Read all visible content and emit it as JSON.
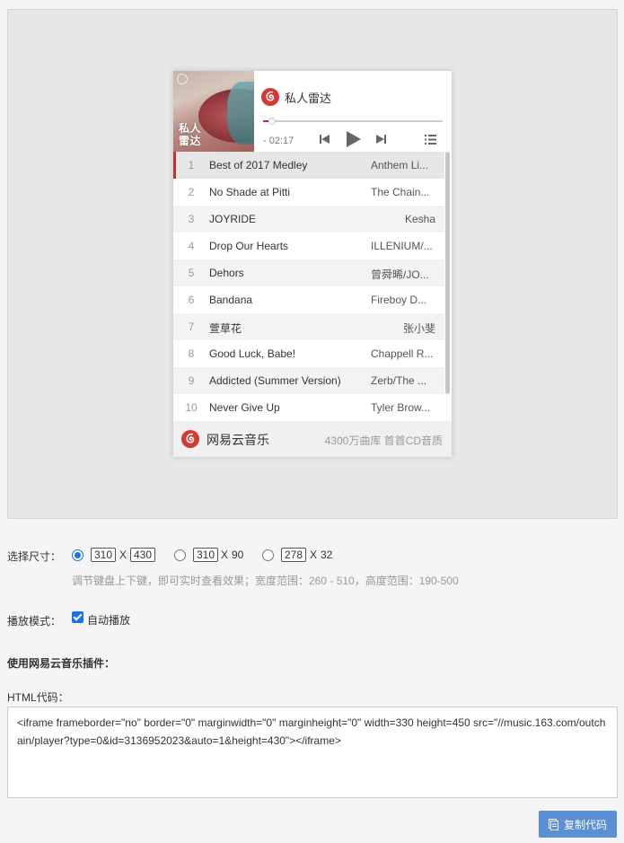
{
  "player": {
    "cover_text": "私人雷达",
    "title": "私人雷达",
    "time": "- 02:17",
    "progress": 0.05,
    "songs": [
      {
        "num": "1",
        "title": "Best of 2017 Medley",
        "artist": "Anthem Li..."
      },
      {
        "num": "2",
        "title": "No Shade at Pitti",
        "artist": "The Chain..."
      },
      {
        "num": "3",
        "title": "JOYRIDE",
        "artist": "Kesha"
      },
      {
        "num": "4",
        "title": "Drop Our Hearts",
        "artist": "ILLENIUM/..."
      },
      {
        "num": "5",
        "title": "Dehors",
        "artist": "曾舜晞/JO..."
      },
      {
        "num": "6",
        "title": "Bandana",
        "artist": "Fireboy D..."
      },
      {
        "num": "7",
        "title": "萱草花",
        "artist": "张小斐"
      },
      {
        "num": "8",
        "title": "Good Luck, Babe!",
        "artist": "Chappell R..."
      },
      {
        "num": "9",
        "title": "Addicted (Summer Version)",
        "artist": "Zerb/The ..."
      },
      {
        "num": "10",
        "title": "Never Give Up",
        "artist": "Tyler Brow..."
      }
    ],
    "footer_brand": "网易云音乐",
    "footer_tagline": "4300万曲库 首首CD音质",
    "accent_color": "#c62f2f"
  },
  "size": {
    "label": "选择尺寸：",
    "options": [
      {
        "w": "310",
        "x": "X",
        "h": "430",
        "checked": true
      },
      {
        "w": "310",
        "x": "X",
        "h": "90",
        "checked": false
      },
      {
        "w": "278",
        "x": "X",
        "h": "32",
        "checked": false
      }
    ],
    "hint": "调节键盘上下键，即可实时查看效果；宽度范围：260 - 510，高度范围：190-500"
  },
  "playmode": {
    "label": "播放模式：",
    "autoplay_label": "自动播放",
    "autoplay": true
  },
  "plugin_title": "使用网易云音乐插件：",
  "code_label": "HTML代码：",
  "code": "<iframe frameborder=\"no\" border=\"0\" marginwidth=\"0\" marginheight=\"0\" width=330 height=450 src=\"//music.163.com/outchain/player?type=0&id=3136952023&auto=1&height=430\"></iframe>",
  "copy_button": "复制代码",
  "brand_color": "#5b8fd6"
}
